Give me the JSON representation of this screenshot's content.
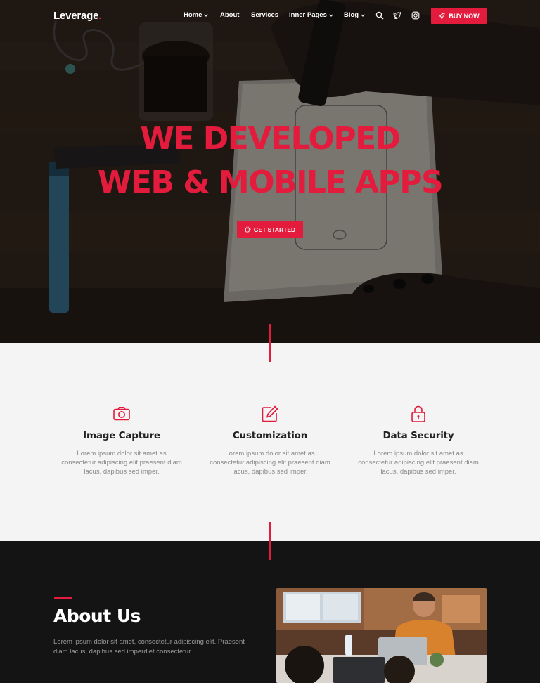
{
  "brand": {
    "name": "Leverage",
    "dot": ".",
    "accent": "#e31b3c"
  },
  "nav": {
    "items": [
      {
        "label": "Home",
        "dropdown": true
      },
      {
        "label": "About",
        "dropdown": false
      },
      {
        "label": "Services",
        "dropdown": false
      },
      {
        "label": "Inner Pages",
        "dropdown": true
      },
      {
        "label": "Blog",
        "dropdown": true
      }
    ],
    "icons": [
      "search-icon",
      "twitter-icon",
      "instagram-icon"
    ],
    "buy_label": "BUY NOW",
    "buy_icon": "rocket-icon"
  },
  "hero": {
    "line1": "WE DEVELOPED",
    "line2": "WEB & MOBILE APPS",
    "cta_label": "GET STARTED",
    "cta_icon": "coffee-icon"
  },
  "features": [
    {
      "icon": "camera-icon",
      "title": "Image Capture",
      "text": "Lorem ipsum dolor sit amet as consectetur adipiscing elit praesent diam lacus, dapibus sed imper."
    },
    {
      "icon": "edit-icon",
      "title": "Customization",
      "text": "Lorem ipsum dolor sit amet as consectetur adipiscing elit praesent diam lacus, dapibus sed imper."
    },
    {
      "icon": "lock-icon",
      "title": "Data Security",
      "text": "Lorem ipsum dolor sit amet as consectetur adipiscing elit praesent diam lacus, dapibus sed imper."
    }
  ],
  "about": {
    "title": "About Us",
    "text": "Lorem ipsum dolor sit amet, consectetur adipiscing elit. Praesent diam lacus, dapibus sed imperdiet consectetur."
  }
}
